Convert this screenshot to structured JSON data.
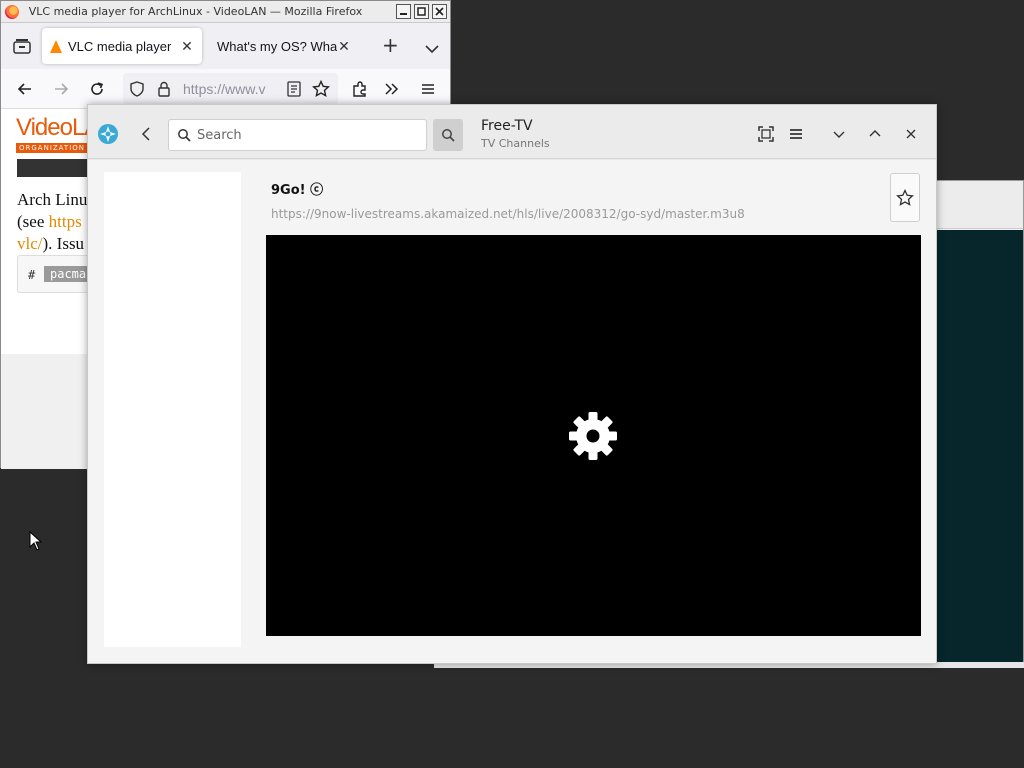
{
  "firefox": {
    "window_title": "VLC media player for ArchLinux - VideoLAN — Mozilla Firefox",
    "wm_buttons": {
      "minimize": "□",
      "maximize": "□",
      "close": "✕"
    },
    "tabs": [
      {
        "label": "VLC media player",
        "close": "✕"
      },
      {
        "label": "What's my OS? What",
        "close": "✕"
      }
    ],
    "new_tab": "+",
    "url": "https://www.v",
    "page": {
      "logo_text": "VideoLA",
      "logo_org": "ORGANIZATION",
      "line1": "Arch Linu",
      "line2_prefix": "(see ",
      "line2_link": "https",
      "line3_link": "vlc/",
      "line3_suffix": "). Issu",
      "code_prompt": "#",
      "code_cmd": "pacma"
    }
  },
  "freetv": {
    "search_placeholder": "Search",
    "title": "Free-TV",
    "subtitle": "TV Channels",
    "channel": {
      "name": "9Go! ⓒ",
      "url": "https://9now-livestreams.akamaized.net/hls/live/2008312/go-syd/master.m3u8"
    }
  }
}
